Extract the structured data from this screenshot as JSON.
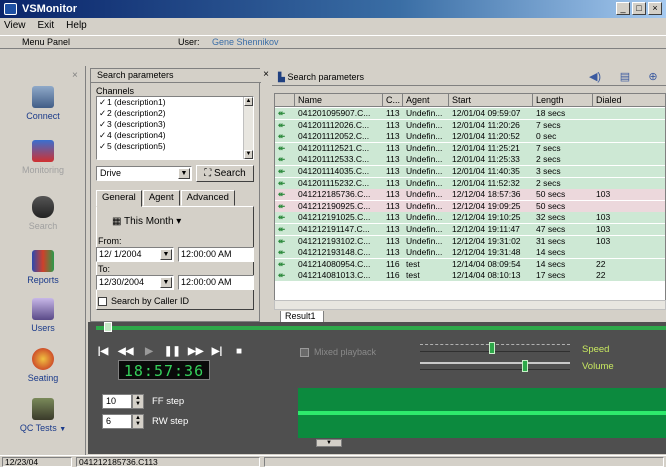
{
  "window": {
    "title": "VSMonitor",
    "controls": [
      "_",
      "□",
      "×"
    ]
  },
  "menu": [
    "View",
    "Exit",
    "Help"
  ],
  "menu_panel": {
    "label": "Menu Panel",
    "user_label": "User:",
    "user_name": "Gene Shennikov"
  },
  "sidebar": {
    "items": [
      {
        "label": "Connect",
        "icon": "computer-icon"
      },
      {
        "label": "Monitoring",
        "icon": "monitoring-icon",
        "dim": true
      },
      {
        "label": "Search",
        "icon": "binoculars-icon",
        "dim": true
      },
      {
        "label": "Reports",
        "icon": "reports-icon"
      },
      {
        "label": "Users",
        "icon": "users-icon"
      },
      {
        "label": "Seating",
        "icon": "seating-icon"
      },
      {
        "label": "QC Tests",
        "icon": "qc-tests-icon"
      }
    ]
  },
  "search_panel": {
    "title": "Search parameters",
    "channels_label": "Channels",
    "channels": [
      "1 (description1)",
      "2 (description2)",
      "3 (description3)",
      "4 (description4)",
      "5 (description5)"
    ],
    "source": "Drive",
    "search_button": "Search",
    "tabs": [
      "General",
      "Agent",
      "Advanced"
    ],
    "period": "This Month",
    "from_label": "From:",
    "from_date": "12/ 1/2004",
    "from_time": "12:00:00 AM",
    "to_label": "To:",
    "to_date": "12/30/2004",
    "to_time": "12:00:00 AM",
    "caller_id_label": "Search by Caller ID"
  },
  "results": {
    "toolbar_title": "Search parameters",
    "columns": [
      "Name",
      "C...",
      "Agent",
      "Start",
      "Length",
      "Dialed"
    ],
    "rows": [
      [
        "041201095907.C...",
        "113",
        "Undefin...",
        "12/01/04 09:59:07",
        "18 secs",
        ""
      ],
      [
        "041201112026.C...",
        "113",
        "Undefin...",
        "12/01/04 11:20:26",
        "7 secs",
        ""
      ],
      [
        "041201112052.C...",
        "113",
        "Undefin...",
        "12/01/04 11:20:52",
        "0 sec",
        ""
      ],
      [
        "041201112521.C...",
        "113",
        "Undefin...",
        "12/01/04 11:25:21",
        "7 secs",
        ""
      ],
      [
        "041201112533.C...",
        "113",
        "Undefin...",
        "12/01/04 11:25:33",
        "2 secs",
        ""
      ],
      [
        "041201114035.C...",
        "113",
        "Undefin...",
        "12/01/04 11:40:35",
        "3 secs",
        ""
      ],
      [
        "041201115232.C...",
        "113",
        "Undefin...",
        "12/01/04 11:52:32",
        "2 secs",
        ""
      ],
      [
        "041212185736.C...",
        "113",
        "Undefin...",
        "12/12/04 18:57:36",
        "50 secs",
        "103"
      ],
      [
        "041212190925.C...",
        "113",
        "Undefin...",
        "12/12/04 19:09:25",
        "50 secs",
        ""
      ],
      [
        "041212191025.C...",
        "113",
        "Undefin...",
        "12/12/04 19:10:25",
        "32 secs",
        "103"
      ],
      [
        "041212191147.C...",
        "113",
        "Undefin...",
        "12/12/04 19:11:47",
        "47 secs",
        "103"
      ],
      [
        "041212193102.C...",
        "113",
        "Undefin...",
        "12/12/04 19:31:02",
        "31 secs",
        "103"
      ],
      [
        "041212193148.C...",
        "113",
        "Undefin...",
        "12/12/04 19:31:48",
        "14 secs",
        ""
      ],
      [
        "041214080954.C...",
        "116",
        "test",
        "12/14/04 08:09:54",
        "14 secs",
        "22"
      ],
      [
        "041214081013.C...",
        "116",
        "test",
        "12/14/04 08:10:13",
        "17 secs",
        "22"
      ]
    ],
    "result_tab": "Result1"
  },
  "player": {
    "time": "18:57:36",
    "controls": [
      "|◀",
      "◀◀",
      "▶",
      "❚❚",
      "▶▶",
      "▶|",
      "■"
    ],
    "mixed_playback": "Mixed playback",
    "speed_label": "Speed",
    "volume_label": "Volume",
    "speed_level": 0.48,
    "volume_level": 0.7,
    "ff_value": "10",
    "ff_label": "FF step",
    "rw_value": "6",
    "rw_label": "RW step"
  },
  "status": {
    "left": "12/23/04 18:57:11",
    "right": "041212185736.C113"
  },
  "colors": {
    "accent_green": "#2ea84a",
    "row_pink": "#ecd8dc",
    "row_green": "#cde8d4"
  }
}
